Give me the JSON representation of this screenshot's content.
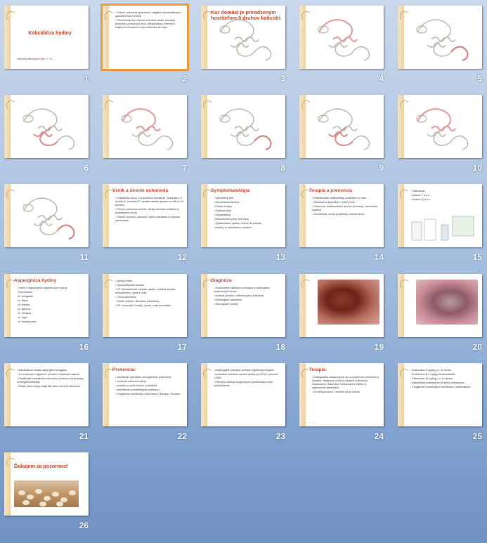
{
  "slides": [
    {
      "num": "1",
      "type": "title",
      "title": "Kokcidióza hydiny",
      "subtitle": "Katarína Mikulášová       3ab.        3 / VL"
    },
    {
      "num": "2",
      "type": "text",
      "title": "",
      "bullets": [
        "Črevné ochorenie spôsobené obligátne intracelulárnymi parazitmi rodu Eimeria",
        "Rozmnožujú sa v sliznici črevného traktu, porušujú funkčnosť a resorbciu živín- dehydratácia, anémia a zvýšená vnímavosť k iným infekciám až úhyn"
      ],
      "selected": true
    },
    {
      "num": "3",
      "type": "sketch",
      "title": "Kur domáci je prirodzeným hostiteľom 9 druhov kokcídií:"
    },
    {
      "num": "4",
      "type": "sketch",
      "title": ""
    },
    {
      "num": "5",
      "type": "sketch",
      "title": ""
    },
    {
      "num": "6",
      "type": "sketch",
      "title": ""
    },
    {
      "num": "7",
      "type": "sketch",
      "title": ""
    },
    {
      "num": "8",
      "type": "sketch",
      "title": ""
    },
    {
      "num": "9",
      "type": "sketch",
      "title": ""
    },
    {
      "num": "10",
      "type": "sketch",
      "title": ""
    },
    {
      "num": "11",
      "type": "sketch",
      "title": ""
    },
    {
      "num": "12",
      "type": "text",
      "title": "Vznik a šírenie ochorenia",
      "bullets": [
        "Kokcidióza chovy, 3-6 týždňové kurčatá (E. acervulina, E. tenella, E. maxima) E. necatrix-staršie jedince vo veku 8-16 týždňov.",
        "Prenos ochorenia za kolá: všetky vnímavé hostitelia a podmienené chovy",
        "Šírenie: suchom, prachom, inými zvieratami a hmyzom, pomôckami"
      ]
    },
    {
      "num": "13",
      "type": "text",
      "title": "Symptomatológia",
      "bullets": [
        "Spomalený rast",
        "Zlá konverzia krmiva",
        "Pokles znášky",
        "Zvýšený úhyn",
        "Dehydratácia",
        "Nesúchorené perie bez lesku",
        "Vyhladovanie, apatia, nechuť do pohybu",
        "Hnačky so znečistenou kloakou"
      ]
    },
    {
      "num": "14",
      "type": "text",
      "title": "Terapia a prevencia",
      "bullets": [
        "Antikokcidiká, sulfonamidy, podávané vo vode",
        "Toltrazuril a amprolium v pitnej vode",
        "Prevencia: antikokcidiká v krmive (ionofory), vakcinácia, hygiena",
        "Dezinfekcia, suchá podstielka, rotácia liekov"
      ]
    },
    {
      "num": "15",
      "type": "vaccine",
      "title": "",
      "bullets": [
        "Vakcinácia:",
        "Livacox T a.u.v.",
        "Livacox Q a.u.v."
      ]
    },
    {
      "num": "16",
      "type": "text",
      "title": "Aspergilóza hydiny",
      "bullets": [
        "Jedna z najčastejších systémových mykóz",
        "Pôvodcovia:",
        "A. fumigatus",
        "A. flavus",
        "A. terreus",
        "A. glaucus",
        "A. nidulans",
        "A. niger",
        "A. amstelodami"
      ]
    },
    {
      "num": "17",
      "type": "text",
      "title": "",
      "bullets": [
        "Akútna forma",
        "Novovyliahnuté kurčatá",
        "KP: dýchavičnosť, hnačka, apatia, zvýšená teplota, nechutenstvo, výtok z nosa",
        "Chronická forma",
        "Staršie jedince, dlhodobé podmienky",
        "KP: chudnutie, hnačky, únava, znížená znáška"
      ]
    },
    {
      "num": "18",
      "type": "text",
      "title": "Diagnóza",
      "bullets": [
        "Zhodnotenie klinických príznakov a patologicko-anatomických zmien",
        "Izolácia pôvodcu, mikroskopia a kultivácia",
        "Histologické vyšetrenie",
        "Sérologické metódy"
      ]
    },
    {
      "num": "19",
      "type": "photo",
      "photo": "a",
      "title": ""
    },
    {
      "num": "20",
      "type": "photo",
      "photo": "b",
      "title": ""
    },
    {
      "num": "21",
      "type": "text",
      "title": "",
      "bullets": [
        "Intrakutánna invázia aspergillus fumigatus",
        "Vo vnútorných orgánoch, pľúcach, vzdušných vakoch",
        "Postihnutie centrálneho nervového systému má príznaky meningoencefalitídy",
        "Rôzne časti mozgu majú žlté alebo červené sfarbenie"
      ]
    },
    {
      "num": "22",
      "type": "text",
      "title": "Prevencia:",
      "bullets": [
        "dodržiavať optimálne zoohygienické podmienky",
        "zvyšovať odolnosť hydiny",
        "kvalitné a suché krmivo, podstielka",
        "dezinfekcia chovateľských priestorov",
        "Fungicídne prostriedky: Enilconazol, Bioclean, Parasan"
      ]
    },
    {
      "num": "23",
      "type": "text",
      "title": "",
      "bullets": [
        "Antifungálne prípravky na báze organických kyselín",
        "podávanie vodného roztoku kysliny (CuSO4) v pomere 1:2000",
        "Priestory ošetrujú fungicídnymi prostriedkami pred naskladnením"
      ]
    },
    {
      "num": "24",
      "type": "text",
      "title": "Terapia:",
      "bullets": [
        "Antimykotiká nasadzujeme na: a) polyénové (amfotericín, nystatín, natamycín a iné) b) azolové (mikonazol, ketokonazol, flukonazol, itrakonazol a ďalšie) c) alylamínové (terbinafín)",
        "Vo veľkochovoch - liečenie nie je účinné"
      ]
    },
    {
      "num": "25",
      "type": "text",
      "title": "",
      "bullets": [
        "Itrakonazol 6 mg/kg p.o. 2x denne",
        "Amfotericín B 1 mg/kg intratracheálne",
        "Flukonazol 15 mg/kg p.o. 2x denne",
        "Nebulizácia amfotericínu B alebo klotrimazolu",
        "Fungicídne prostriedky v kombinácii s antibiotikami"
      ]
    },
    {
      "num": "26",
      "type": "thanks",
      "title": "Ďakujem za pozornosť"
    }
  ],
  "colors": {
    "title": "#b9482f",
    "selection": "#e79a3c",
    "accent_bar": "#ead2a4"
  }
}
